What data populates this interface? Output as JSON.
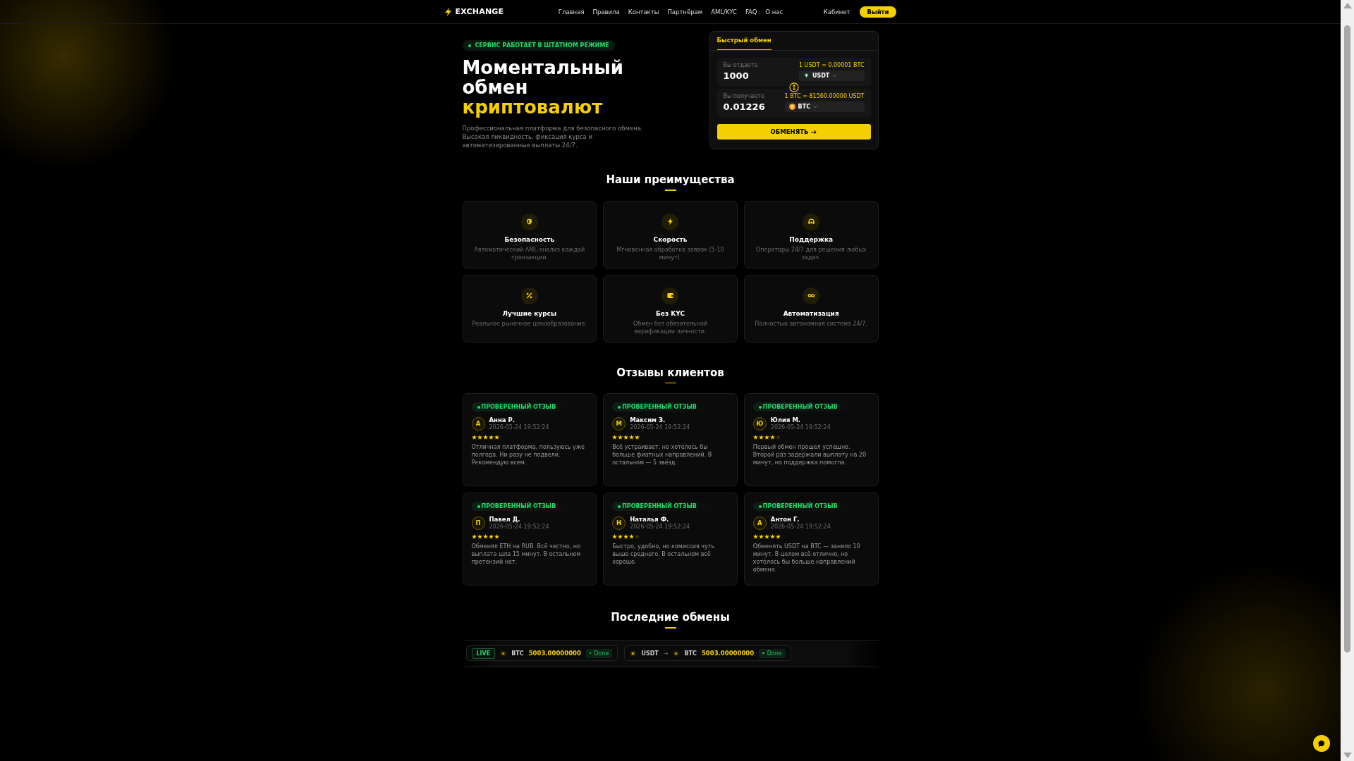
{
  "header": {
    "logo": "EXCHANGE",
    "nav": [
      "Главная",
      "Правила",
      "Контакты",
      "Партнёрам",
      "AML/KYC",
      "FAQ",
      "О нас"
    ],
    "cabinet": "Кабинет",
    "logout": "Выйти"
  },
  "hero": {
    "status": "СЕРВИС РАБОТАЕТ В ШТАТНОМ РЕЖИМЕ",
    "title_lines": [
      "Моментальный",
      "обмен"
    ],
    "title_accent": "криптовалют",
    "description": "Профессиональная платформа для безопасного обмена. Высокая ликвидность, фиксация курса и автоматизированные выплаты 24/7."
  },
  "exchange": {
    "tabs": [
      {
        "label": "Быстрый обмен",
        "selected": true
      }
    ],
    "fields": [
      {
        "label": "Вы отдаете",
        "rate": "1 USDT = 0.00001 BTC",
        "value": "1000",
        "currency": "USDT",
        "kind": "usdt"
      },
      {
        "label": "Вы получаете",
        "rate": "1 BTC = 81560.00000 USDT",
        "value": "0.01226",
        "currency": "BTC",
        "kind": "btc"
      }
    ],
    "button": "ОБМЕНЯТЬ"
  },
  "advantages": {
    "title": "Наши преимущества",
    "items": [
      {
        "kind": "shield",
        "title": "Безопасность",
        "text": "Автоматический AML-анализ каждой транзакции."
      },
      {
        "kind": "bolt",
        "title": "Скорость",
        "text": "Мгновенная обработка заявок (5-10 минут)."
      },
      {
        "kind": "headset",
        "title": "Поддержка",
        "text": "Операторы 24/7 для решения любых задач."
      },
      {
        "kind": "percent",
        "title": "Лучшие курсы",
        "text": "Реальное рыночное ценообразование."
      },
      {
        "kind": "wallet",
        "title": "Без KYC",
        "text": "Обмен без обязательной верификации личности."
      },
      {
        "kind": "infinity",
        "title": "Автоматизация",
        "text": "Полностью автономная система 24/7."
      }
    ]
  },
  "reviews": {
    "title": "Отзывы клиентов",
    "items": [
      {
        "badge": "ПРОВЕРЕННЫЙ ОТЗЫВ",
        "initial": "А",
        "name": "Анна Р.",
        "date": "2026-05-24 19:52:24",
        "stars": 5,
        "text": "Отличная платформа, пользуюсь уже полгода. Ни разу не подвели. Рекомендую всем."
      },
      {
        "badge": "ПРОВЕРЕННЫЙ ОТЗЫВ",
        "initial": "М",
        "name": "Максим З.",
        "date": "2026-05-24 19:52:24",
        "stars": 5,
        "text": "Всё устраивает, но хотелось бы больше фиатных направлений. В остальном — 5 звёзд."
      },
      {
        "badge": "ПРОВЕРЕННЫЙ ОТЗЫВ",
        "initial": "Ю",
        "name": "Юлия М.",
        "date": "2026-05-24 19:52:24",
        "stars": 4,
        "text": "Первый обмен прошел успешно. Второй раз задержали выплату на 20 минут, но поддержка помогла."
      },
      {
        "badge": "ПРОВЕРЕННЫЙ ОТЗЫВ",
        "initial": "П",
        "name": "Павел Д.",
        "date": "2026-05-24 19:52:24",
        "stars": 5,
        "text": "Обменял ETH на RUB. Всё честно, но выплата шла 15 минут. В остальном претензий нет."
      },
      {
        "badge": "ПРОВЕРЕННЫЙ ОТЗЫВ",
        "initial": "Н",
        "name": "Наталья Ф.",
        "date": "2026-05-24 19:52:24",
        "stars": 4,
        "text": "Быстро, удобно, но комиссия чуть выше среднего. В остальном всё хорошо."
      },
      {
        "badge": "ПРОВЕРЕННЫЙ ОТЗЫВ",
        "initial": "А",
        "name": "Антон Г.",
        "date": "2026-05-24 19:52:24",
        "stars": 5,
        "text": "Обменять USDT на BTC — заняло 10 минут. В целом всё отлично, но хотелось бы больше направлений обмена."
      }
    ]
  },
  "recent": {
    "title": "Последние обмены",
    "live": "LIVE",
    "items": [
      {
        "to": "BTC",
        "amount": "5003.00000000",
        "status": "Done"
      },
      {
        "from": "USDT",
        "arrow": "→",
        "to": "BTC",
        "amount": "5003.00000000",
        "status": "Done"
      }
    ]
  }
}
